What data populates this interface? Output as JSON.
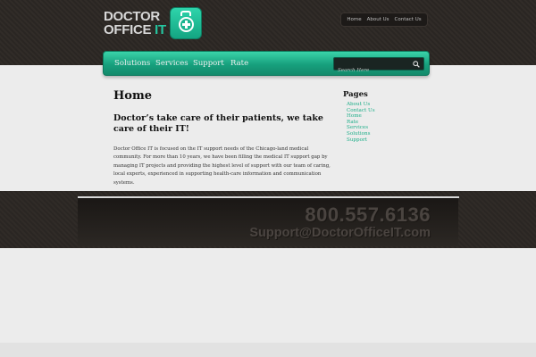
{
  "logo": {
    "line1": "DOCTOR",
    "line2_a": "OFFICE",
    "line2_b": "IT"
  },
  "top_nav": [
    {
      "label": "Home"
    },
    {
      "label": "About Us"
    },
    {
      "label": "Contact Us"
    }
  ],
  "main_nav": [
    {
      "label": "Solutions"
    },
    {
      "label": "Services"
    },
    {
      "label": "Support"
    },
    {
      "label": "Rate"
    }
  ],
  "search": {
    "placeholder": "Search Here",
    "value": ""
  },
  "content": {
    "title": "Home",
    "subtitle": "Doctor’s take care of their patients, we take care of their IT!",
    "body": "Doctor Office IT is focused on the IT support needs of the Chicago-land medical community. For more than 10 years, we have been filling the medical IT support gap by managing IT projects and providing the highest level of support with our team of caring, local experts, experienced in supporting health-care information and communication systems."
  },
  "sidebar": {
    "heading": "Pages",
    "items": [
      "About Us",
      "Contact Us",
      "Home",
      "Rate",
      "Services",
      "Solutions",
      "Support"
    ]
  },
  "footer": {
    "phone": "800.557.6136",
    "email": "Support@DoctorOfficeIT.com"
  },
  "colors": {
    "accent": "#1eae89",
    "dark_band": "#2c2825",
    "page_bg": "#ececec"
  }
}
